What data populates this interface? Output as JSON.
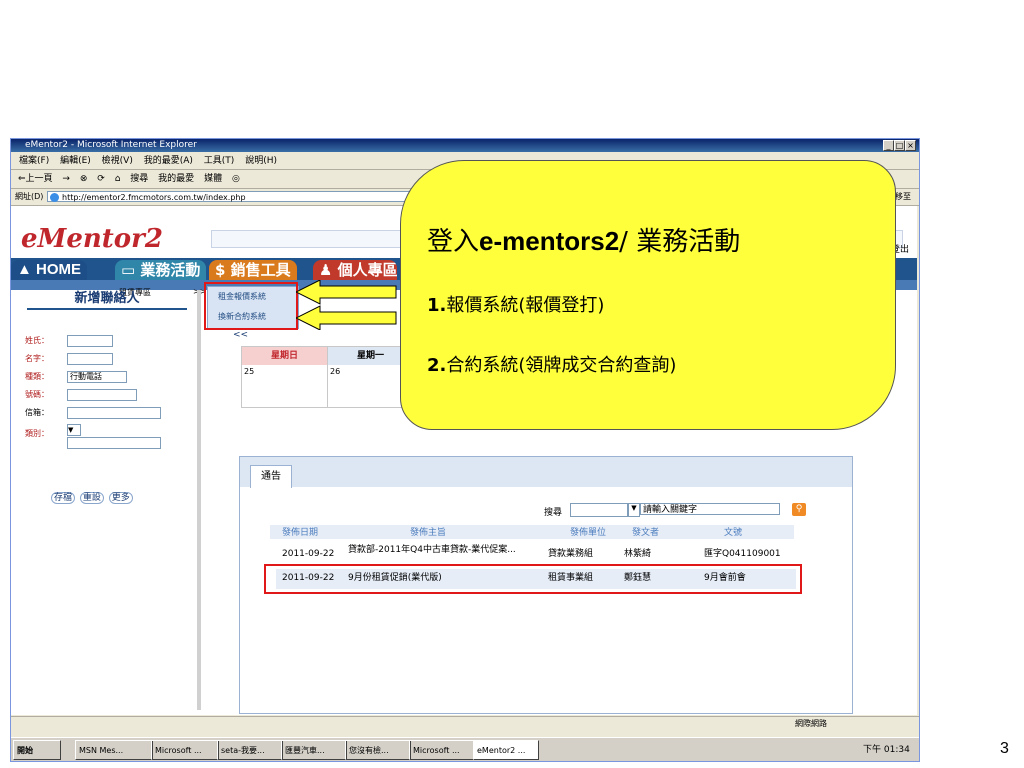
{
  "window": {
    "title": "eMentor2 - Microsoft Internet Explorer",
    "controls": [
      "_",
      "□",
      "×"
    ]
  },
  "menubar": [
    "檔案(F)",
    "編輯(E)",
    "檢視(V)",
    "我的最愛(A)",
    "工具(T)",
    "說明(H)"
  ],
  "toolbar": [
    "⇐上一頁",
    "→",
    "⊗",
    "⟳",
    "⌂",
    "搜尋",
    "我的最愛",
    "媒體",
    "◎"
  ],
  "address": {
    "label": "網址(D)",
    "url": "http://ementor2.fmcmotors.com.tw/index.php",
    "go": "移至"
  },
  "logo": "eMentor2",
  "logout_label": "登出",
  "nav": {
    "home": "HOME",
    "tab1": "業務活動",
    "tab2": "銷售工具",
    "tab3": "個人專區"
  },
  "subnav": {
    "rental": "租賃專區",
    "arrow": ">>"
  },
  "submenu": {
    "item1": "租金報價系統",
    "item2": "換新合約系統"
  },
  "sidebar": {
    "title": "新增聯絡人",
    "surname": "姓氏：",
    "name": "名字：",
    "type": "種類：",
    "type_value": "行動電話",
    "number": "號碼：",
    "email": "信箱：",
    "category": "類別：",
    "buttons": [
      "存檔",
      "重設",
      "更多"
    ]
  },
  "calendar": {
    "nav": "<<",
    "headers": [
      "星期日",
      "星期一"
    ],
    "days": [
      "25",
      "26"
    ]
  },
  "announcement": {
    "tab": "通告",
    "search_label": "搜尋",
    "search_placeholder": "請輸入關鍵字",
    "columns": [
      "發佈日期",
      "發佈主旨",
      "發佈單位",
      "發文者",
      "文號"
    ],
    "rows": [
      {
        "date": "2011-09-22",
        "subject": "貸款部-2011年Q4中古車貸款-業代促案...",
        "unit": "貸款業務組",
        "author": "林紫綺",
        "ref": "匯字Q041109001"
      },
      {
        "date": "2011-09-22",
        "subject": "9月份租賃促銷(業代版)",
        "unit": "租賃事業組",
        "author": "鄭鈺慧",
        "ref": "9月會前會"
      }
    ]
  },
  "status": {
    "zone": "網際網路"
  },
  "taskbar": {
    "start": "開始",
    "tasks": [
      "MSN Mes...",
      "Microsoft ...",
      "seta-我要...",
      "匯豐汽車...",
      "您沒有檢...",
      "Microsoft ...",
      "eMentor2 ..."
    ],
    "clock": "下午 01:34"
  },
  "callout": {
    "title_prefix": "登入",
    "title_bold": "e-mentors2",
    "title_suffix": "/ 業務活動",
    "line1_num": "1.",
    "line1": "報價系統(報價登打)",
    "line2_num": "2.",
    "line2": "合約系統(領牌成交合約查詢)"
  },
  "page_number": "3",
  "colors": {
    "navbar": "#20548c",
    "callout": "#ffff3c",
    "highlight": "#e01818"
  }
}
